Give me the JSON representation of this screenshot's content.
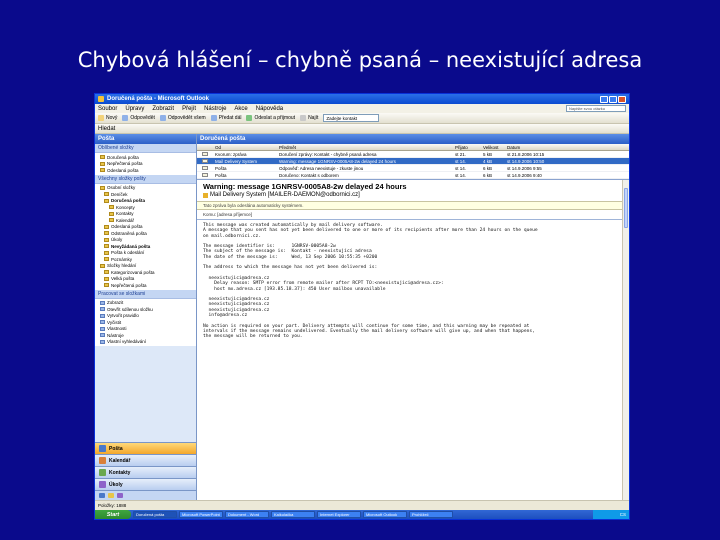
{
  "slide": {
    "title": "Chybová hlášení – chybně psaná – neexistující adresa"
  },
  "window": {
    "title": "Doručená pošta - Microsoft Outlook",
    "menu": [
      "Soubor",
      "Úpravy",
      "Zobrazit",
      "Přejít",
      "Nástroje",
      "Akce",
      "Nápověda"
    ],
    "help_placeholder": "Napište svou otázku",
    "toolbar": {
      "new": "Nový",
      "reply": "Odpovědět",
      "reply_all": "Odpovědět všem",
      "forward": "Předat dál",
      "send_receive": "Odeslat a přijmout",
      "find": "Najít",
      "search_field": "Zadejte kontakt",
      "search_btn": "Hledat"
    }
  },
  "nav": {
    "header": "Pošta",
    "favorites_label": "Oblíbené složky",
    "favorites": [
      "Doručená pošta",
      "Nepřečtená pošta",
      "Odeslaná pošta"
    ],
    "all_folders_label": "Všechny složky pošty",
    "folders": [
      {
        "label": "Osobní složky",
        "indent": 0,
        "bold": false
      },
      {
        "label": "Deníček",
        "indent": 1,
        "bold": false
      },
      {
        "label": "Doručená pošta",
        "indent": 1,
        "bold": true
      },
      {
        "label": "Koncepty",
        "indent": 2,
        "bold": false
      },
      {
        "label": "Kontakty",
        "indent": 2,
        "bold": false
      },
      {
        "label": "Kalendář",
        "indent": 2,
        "bold": false
      },
      {
        "label": "Odeslaná pošta",
        "indent": 1,
        "bold": false
      },
      {
        "label": "Odstraněná pošta",
        "indent": 1,
        "bold": false
      },
      {
        "label": "Úkoly",
        "indent": 1,
        "bold": false
      },
      {
        "label": "Nevyžádaná pošta",
        "indent": 1,
        "bold": true
      },
      {
        "label": "Pošta k odeslání",
        "indent": 1,
        "bold": false
      },
      {
        "label": "Poznámky",
        "indent": 1,
        "bold": false
      },
      {
        "label": "Složky hledání",
        "indent": 0,
        "bold": false
      },
      {
        "label": "Kategorizovaná pošta",
        "indent": 1,
        "bold": false
      },
      {
        "label": "Velká pošta",
        "indent": 1,
        "bold": false
      },
      {
        "label": "Nepřečtená pošta",
        "indent": 1,
        "bold": false
      }
    ],
    "tasks_label": "Pracovat se složkami",
    "tasks": [
      "Zobrazit",
      "Otevřít sdílenou složku",
      "Vytvořit pravidlo",
      "Vyčistit",
      "Vlastnosti",
      "Nástroje",
      "Vlastní vyhledávání"
    ],
    "buttons": [
      {
        "label": "Pošta",
        "active": true,
        "color": "#4a78c8"
      },
      {
        "label": "Kalendář",
        "active": false,
        "color": "#d9803a"
      },
      {
        "label": "Kontakty",
        "active": false,
        "color": "#6aa84f"
      },
      {
        "label": "Úkoly",
        "active": false,
        "color": "#8e63c9"
      }
    ]
  },
  "list": {
    "header": "Doručená pošta",
    "columns": [
      "Od",
      "Předmět",
      "Přijato",
      "Velikost",
      "Datum"
    ],
    "rows": [
      {
        "from": "Kvorum: zpráva",
        "subject": "Doručení zprávy: Kontakt - chybně psaná adresa",
        "received": "st 21.",
        "date": "st 21.8.2006 10:15",
        "size": "5 kB",
        "selected": false
      },
      {
        "from": "Mail Delivery System",
        "subject": "Warning: message 1GNRSV-0005A8-2w delayed 24 hours",
        "received": "st 14.",
        "date": "st 14.9.2006 10:50",
        "size": "4 kB",
        "selected": true
      },
      {
        "from": "Pošta",
        "subject": "Odpověď: Adresa neexistuje - zkuste jinou",
        "received": "st 14.",
        "date": "st 14.9.2006 9:55",
        "size": "6 kB",
        "selected": false
      },
      {
        "from": "Pošta",
        "subject": "Doručeno: Kontakt s odborem",
        "received": "st 14.",
        "date": "st 14.9.2006 9:40",
        "size": "6 kB",
        "selected": false
      }
    ]
  },
  "preview": {
    "subject": "Warning: message 1GNRSV-0005A8-2w delayed 24 hours",
    "from": "Mail Delivery System [MAILER-DAEMON@odbornici.cz]",
    "infobar": "Tato zpráva byla odeslána automaticky systémem.",
    "recipient": "Komu: [adresa příjemce]",
    "body": "This message was created automatically by mail delivery software.\nA message that you sent has not yet been delivered to one or more of its recipients after more than 24 hours on the queue\non mail.odbornici.cz.\n\nThe message identifier is:      1GNRSV-0005A8-2w\nThe subject of the message is:  Kontakt - neexistující adresa\nThe date of the message is:     Wed, 13 Sep 2006 10:55:35 +0200\n\nThe address to which the message has not yet been delivered is:\n\n  neexistujici@adresa.cz\n    Delay reason: SMTP error from remote mailer after RCPT TO:<neexistujici@adresa.cz>:\n    host mx.adresa.cz [193.85.18.37]: 450 User mailbox unavailable\n\n  neexistujici@adresa.cz\n  neexistujici@adresa.cz\n  neexistujici@adresa.cz\n  info@adresa.cz\n\nNo action is required on your part. Delivery attempts will continue for some time, and this warning may be repeated at\nintervals if the message remains undelivered. Eventually the mail delivery software will give up, and when that happens,\nthe message will be returned to you."
  },
  "status": {
    "text": "Položky: 1888"
  },
  "taskbar": {
    "start": "Start",
    "items": [
      "Doručená pošta",
      "Microsoft PowerPoint",
      "Dokument - Word",
      "Kalkulačka",
      "Internet Explorer",
      "Microsoft Outlook",
      "Prohlížeč"
    ],
    "tray": "CS"
  }
}
